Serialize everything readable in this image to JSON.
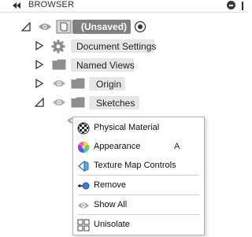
{
  "header": {
    "title": "BROWSER"
  },
  "tree": {
    "root": {
      "label": "(Unsaved)"
    },
    "items": [
      {
        "label": "Document Settings"
      },
      {
        "label": "Named Views"
      },
      {
        "label": "Origin"
      },
      {
        "label": "Sketches"
      }
    ]
  },
  "context_menu": {
    "items": [
      {
        "label": "Physical Material",
        "icon": "physical-material-icon"
      },
      {
        "label": "Appearance",
        "shortcut": "A",
        "icon": "appearance-icon"
      },
      {
        "label": "Texture Map Controls",
        "icon": "texture-map-icon"
      },
      {
        "label": "Remove",
        "icon": "remove-icon"
      },
      {
        "label": "Show All",
        "icon": "show-all-icon"
      },
      {
        "label": "Unisolate",
        "icon": "unisolate-icon"
      }
    ]
  }
}
